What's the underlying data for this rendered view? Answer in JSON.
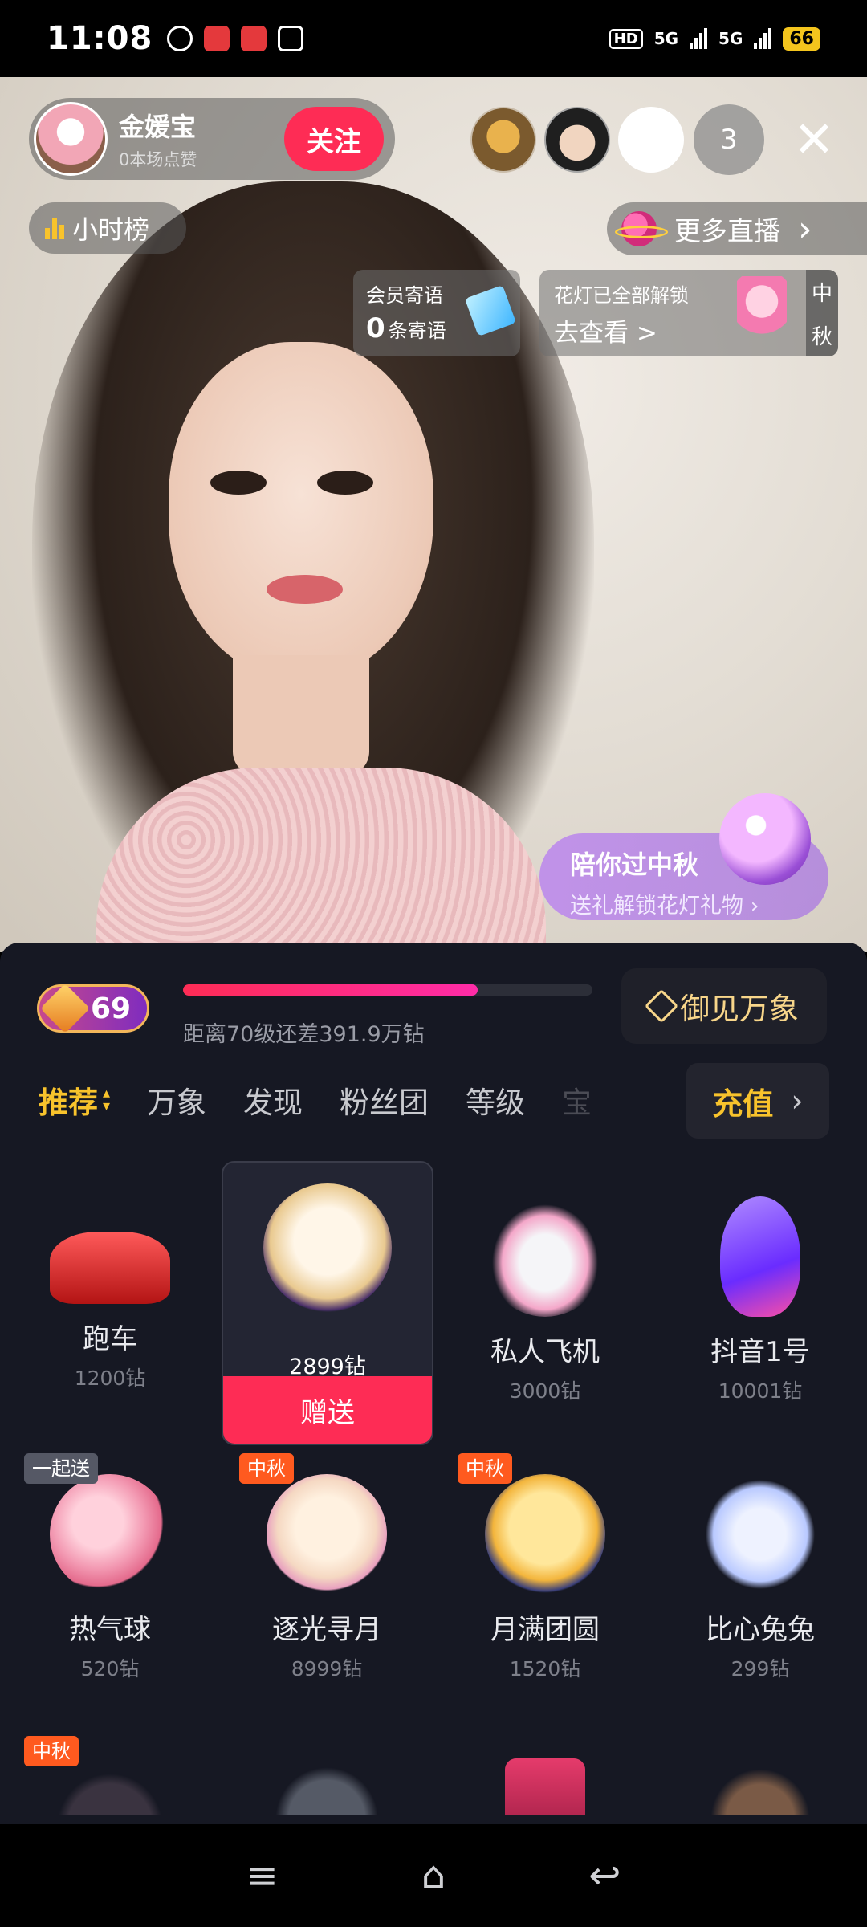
{
  "status_bar": {
    "time": "11:08",
    "hd_label": "HD",
    "net1": "5G",
    "net2": "5G",
    "battery": "66"
  },
  "host": {
    "name": "金媛宝",
    "likes": "0本场点赞",
    "follow_label": "关注"
  },
  "viewers": {
    "count": "3"
  },
  "close_symbol": "✕",
  "hour_rank_label": "小时榜",
  "more_live": {
    "label": "更多直播",
    "chevron": "›"
  },
  "member_card": {
    "line1": "会员寄语",
    "count": "0",
    "line2_suffix": "条寄语"
  },
  "lantern_card": {
    "line1": "花灯已全部解锁",
    "line2": "去查看 >",
    "tag_top": "中",
    "tag_bottom": "秋"
  },
  "promo": {
    "title": "陪你过中秋",
    "subtitle": "送礼解锁花灯礼物 ›"
  },
  "level": {
    "number": "69",
    "progress_pct": 72,
    "progress_text": "距离70级还差391.9万钻"
  },
  "yujian_label": "御见万象",
  "tabs": [
    {
      "label": "推荐",
      "active": true
    },
    {
      "label": "万象"
    },
    {
      "label": "发现"
    },
    {
      "label": "粉丝团"
    },
    {
      "label": "等级"
    },
    {
      "label": "宝"
    }
  ],
  "recharge": {
    "label": "充值",
    "chevron": "›"
  },
  "gifts_row1": [
    {
      "name": "跑车",
      "price": "1200钻",
      "color": "#e23b3b"
    },
    {
      "cost": "2899钻",
      "action": "赠送"
    },
    {
      "name": "私人飞机",
      "price": "3000钻",
      "color": "#f0f0f4"
    },
    {
      "name": "抖音1号",
      "price": "10001钻",
      "color": "#8c4bff"
    }
  ],
  "gifts_row2": [
    {
      "name": "热气球",
      "price": "520钻",
      "tag": "一起送",
      "color": "#f39ab3"
    },
    {
      "name": "逐光寻月",
      "price": "8999钻",
      "tag": "中秋",
      "color": "#f5d8c2"
    },
    {
      "name": "月满团圆",
      "price": "1520钻",
      "tag": "中秋",
      "color": "#f3c86b"
    },
    {
      "name": "比心兔兔",
      "price": "299钻",
      "color": "#b9c9ff"
    }
  ],
  "row3_tag": "中秋",
  "nav": {
    "menu": "≡",
    "home": "⌂",
    "back": "↩"
  }
}
